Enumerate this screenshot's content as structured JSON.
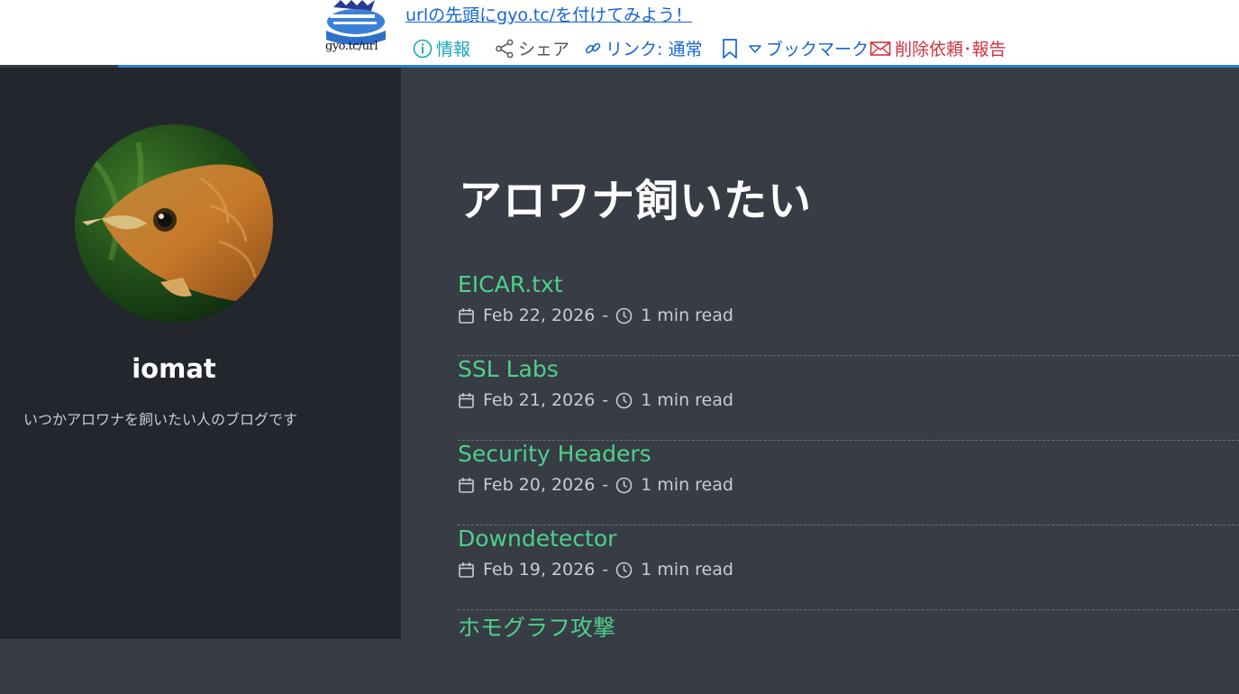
{
  "toolbar": {
    "logo_text": "gyo.tc/url",
    "top_link": "urlの先頭にgyo.tc/を付けてみよう！",
    "info": "情報",
    "share": "シェア",
    "link": "リンク: 通常",
    "bookmark": "ブックマーク",
    "report": "削除依頼･報告"
  },
  "sidebar": {
    "author_name": "iomat",
    "bio": "いつかアロワナを飼いたい人のブログです"
  },
  "main": {
    "title": "アロワナ飼いたい",
    "posts": [
      {
        "title": "EICAR.txt",
        "date": "Feb 22, 2026",
        "read": "1 min read"
      },
      {
        "title": "SSL Labs",
        "date": "Feb 21, 2026",
        "read": "1 min read"
      },
      {
        "title": "Security Headers",
        "date": "Feb 20, 2026",
        "read": "1 min read"
      },
      {
        "title": "Downdetector",
        "date": "Feb 19, 2026",
        "read": "1 min read"
      },
      {
        "title": "ホモグラフ攻撃",
        "date": "",
        "read": ""
      }
    ],
    "meta_separator": "-"
  },
  "colors": {
    "sidebar_bg": "#23262d",
    "main_bg": "#373c45",
    "post_title": "#4fd08b",
    "accent_line": "#2a7fd0"
  }
}
